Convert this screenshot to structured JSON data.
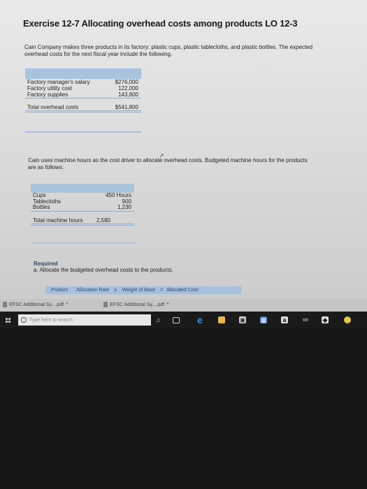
{
  "title": "Exercise 12-7 Allocating overhead costs among products LO 12-3",
  "intro": "Cain Company makes three products in its factory: plastic cups, plastic tablecloths, and plastic bottles. The expected overhead costs for the next fiscal year include the following.",
  "overhead": {
    "items": [
      {
        "label": "Factory manager's salary",
        "value": "$276,000"
      },
      {
        "label": "Factory utility cost",
        "value": "122,000"
      },
      {
        "label": "Factory supplies",
        "value": "143,800"
      }
    ],
    "total_label": "Total overhead costs",
    "total_value": "$541,800"
  },
  "driver_text": "Cain uses machine hours as the cost driver to allocate overhead costs. Budgeted machine hours for the products are as follows:",
  "hours": {
    "items": [
      {
        "label": "Cups",
        "value": "450 Hours"
      },
      {
        "label": "Tablecloths",
        "value": "900"
      },
      {
        "label": "Bottles",
        "value": "1,230"
      }
    ],
    "total_label": "Total machine hours",
    "total_value": "2,580"
  },
  "required": {
    "heading": "Required",
    "item": "a.  Allocate the budgeted overhead costs to the products."
  },
  "alloc_table": {
    "col_product": "Product",
    "col_rate": "Allocation Rate",
    "op_times": "x",
    "col_base": "Weight of Base",
    "op_equals": "=",
    "col_cost": "Allocated Cost"
  },
  "downloads": [
    {
      "name": "EFSC Additional Sy....pdf",
      "icon": "pdf-icon"
    },
    {
      "name": "EFSC Additional Sy....pdf",
      "icon": "pdf-icon"
    }
  ],
  "taskbar": {
    "search_placeholder": "Type here to search",
    "icons": [
      "microphone-icon",
      "task-view-icon",
      "edge-icon",
      "file-explorer-icon",
      "store-icon",
      "calculator-icon",
      "amazon-icon",
      "infinity-icon",
      "app-icon",
      "chrome-icon"
    ]
  }
}
